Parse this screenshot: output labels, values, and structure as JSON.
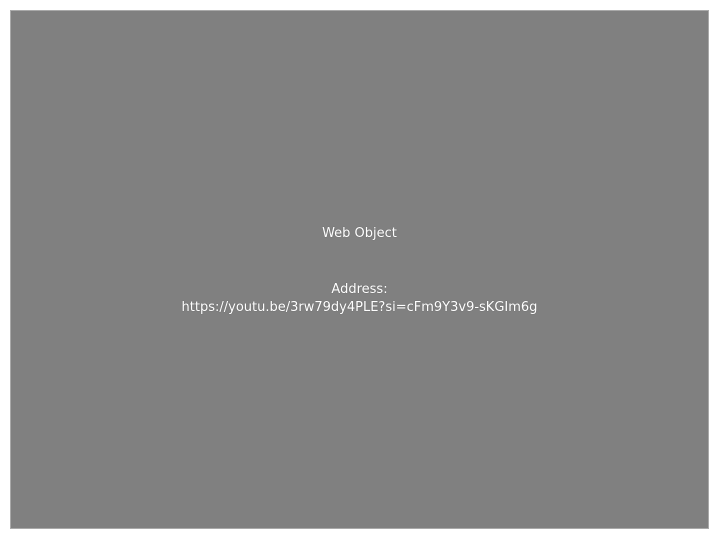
{
  "web_object": {
    "title": "Web Object",
    "address_label": "Address:",
    "address_url": "https://youtu.be/3rw79dy4PLE?si=cFm9Y3v9-sKGIm6g",
    "colors": {
      "background": "#808080",
      "text": "#ffffff"
    }
  }
}
